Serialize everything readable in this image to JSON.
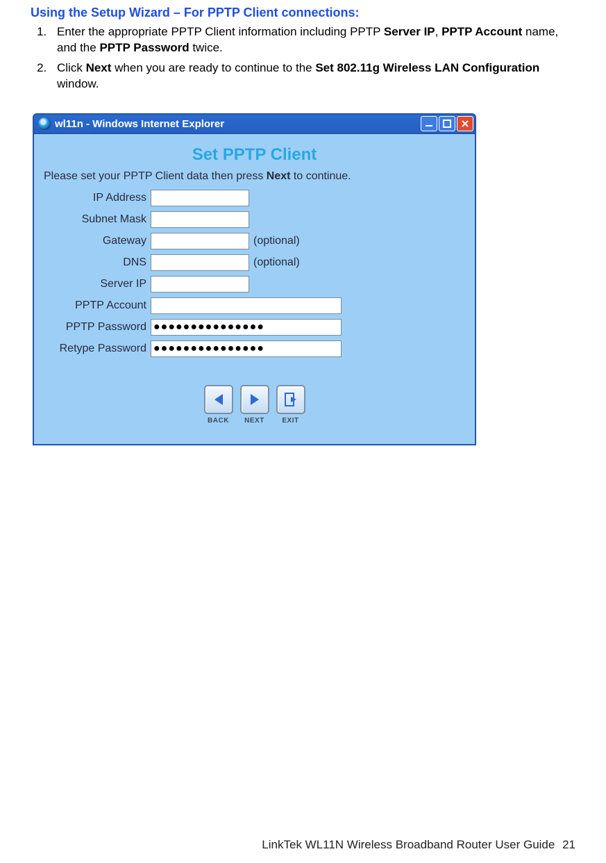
{
  "heading": "Using the Setup Wizard – For PPTP Client connections:",
  "steps": {
    "step1": {
      "prefix": "Enter the appropriate PPTP Client information including PPTP ",
      "b1": "Server IP",
      "sep1": ", ",
      "b2": "PPTP Account",
      "mid": " name, and the ",
      "b3": "PPTP Password",
      "suffix": " twice."
    },
    "step2": {
      "prefix": "Click ",
      "b1": "Next",
      "mid": " when you are ready to continue to the ",
      "b2": "Set 802.11g Wireless LAN Configuration",
      "suffix": " window."
    }
  },
  "window": {
    "title": "wl11n - Windows Internet Explorer",
    "body_title": "Set PPTP Client",
    "instruction": {
      "prefix": "Please set your PPTP Client data then press ",
      "bold": "Next",
      "suffix": " to continue."
    },
    "labels": {
      "ip": "IP Address",
      "subnet": "Subnet Mask",
      "gateway": "Gateway",
      "dns": "DNS",
      "server_ip": "Server IP",
      "account": "PPTP Account",
      "password": "PPTP Password",
      "retype": "Retype Password",
      "optional": "(optional)"
    },
    "values": {
      "ip": "",
      "subnet": "",
      "gateway": "",
      "dns": "",
      "server_ip": "",
      "account": "",
      "password": "●●●●●●●●●●●●●●●",
      "retype": "●●●●●●●●●●●●●●●"
    },
    "nav": {
      "back": "BACK",
      "next": "NEXT",
      "exit": "EXIT"
    }
  },
  "footer": {
    "text": "LinkTek WL11N Wireless Broadband Router User Guide",
    "page": "21"
  }
}
